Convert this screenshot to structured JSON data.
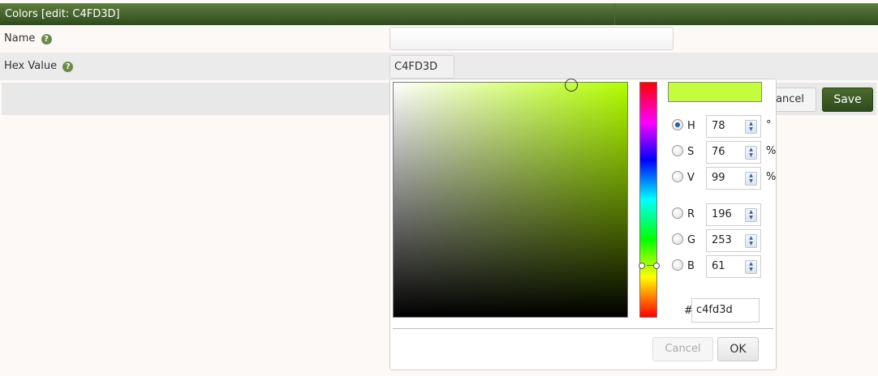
{
  "window": {
    "title": "Colors [edit: C4FD3D]"
  },
  "form": {
    "name_label": "Name",
    "name_value": "",
    "hex_label": "Hex Value",
    "hex_value": "C4FD3D",
    "help_icon": "question-circle-icon",
    "cancel_label": "Cancel",
    "save_label": "Save"
  },
  "picker": {
    "current_color": "#c4fd3d",
    "hue_color": "#a8ff00",
    "fields": [
      {
        "key": "H",
        "value": "78",
        "unit": "°",
        "selected": true
      },
      {
        "key": "S",
        "value": "76",
        "unit": "%",
        "selected": false
      },
      {
        "key": "V",
        "value": "99",
        "unit": "%",
        "selected": false
      },
      {
        "key": "R",
        "value": "196",
        "unit": "",
        "selected": false
      },
      {
        "key": "G",
        "value": "253",
        "unit": "",
        "selected": false
      },
      {
        "key": "B",
        "value": "61",
        "unit": "",
        "selected": false
      }
    ],
    "hex_prefix": "#",
    "hex_value": "c4fd3d",
    "cancel_label": "Cancel",
    "ok_label": "OK"
  },
  "colors": {
    "header_green": "#3d5c27",
    "save_green": "#2f4a1e",
    "accent_radio": "#1e5fa8"
  }
}
